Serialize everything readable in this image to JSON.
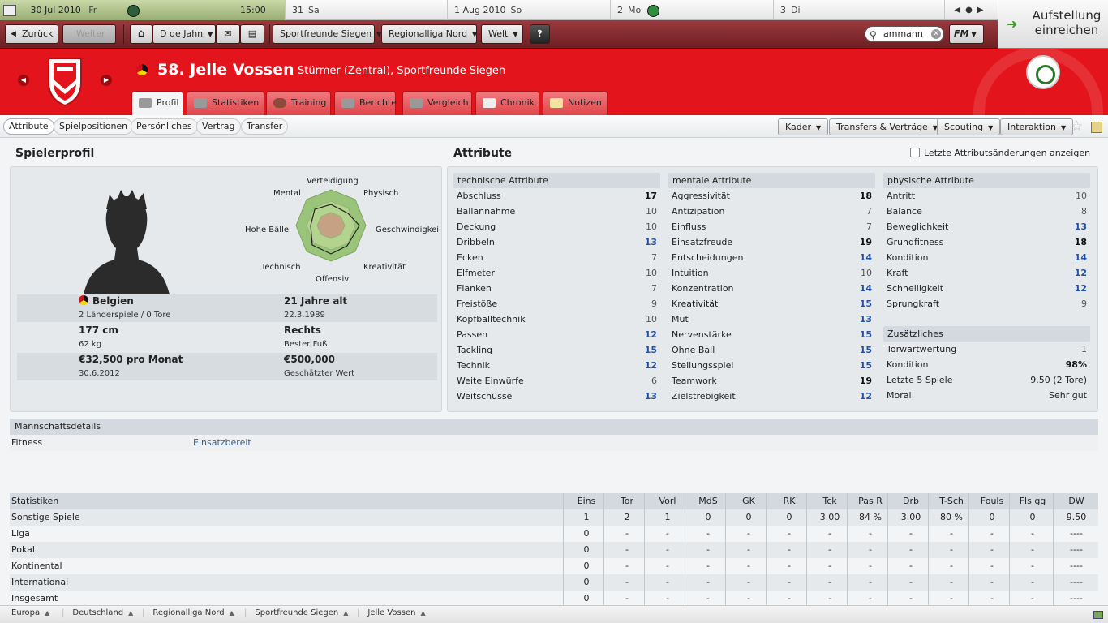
{
  "calendar": [
    {
      "day": "30 Jul 2010",
      "weekday": "Fr",
      "time": "15:00",
      "today": true
    },
    {
      "day": "31",
      "weekday": "Sa"
    },
    {
      "day": "1 Aug 2010",
      "weekday": "So"
    },
    {
      "day": "2",
      "weekday": "Mo"
    },
    {
      "day": "3",
      "weekday": "Di"
    }
  ],
  "toolbar": {
    "back": "Zurück",
    "forward": "Weiter",
    "manager": "D de Jahn",
    "club": "Sportfreunde Siegen",
    "league": "Regionalliga Nord",
    "world": "Welt",
    "help": "?",
    "search": "ammann",
    "fm": "FM"
  },
  "continue_label": "Aufstellung einreichen",
  "player": {
    "name": "58. Jelle Vossen",
    "position": "Stürmer (Zentral), Sportfreunde Siegen"
  },
  "tabs": [
    "Profil",
    "Statistiken",
    "Training",
    "Berichte",
    "Vergleich",
    "Chronik",
    "Notizen"
  ],
  "subtabs": [
    "Attribute",
    "Spielpositionen",
    "Persönliches",
    "Vertrag",
    "Transfer"
  ],
  "menus": [
    "Kader",
    "Transfers & Verträge",
    "Scouting",
    "Interaktion"
  ],
  "profile": {
    "title": "Spielerprofil",
    "radar": [
      "Verteidigung",
      "Physisch",
      "Geschwindigkei",
      "Kreativität",
      "Offensiv",
      "Technisch",
      "Hohe Bälle",
      "Mental"
    ],
    "nation": "Belgien",
    "caps": "2 Länderspiele / 0 Tore",
    "age": "21 Jahre alt",
    "dob": "22.3.1989",
    "height": "177 cm",
    "weight": "62 kg",
    "foot": "Rechts",
    "foot_label": "Bester Fuß",
    "wage": "€32,500 pro Monat",
    "contract": "30.6.2012",
    "value": "€500,000",
    "value_label": "Geschätzter Wert"
  },
  "attributes": {
    "title": "Attribute",
    "toggle": "Letzte Attributsänderungen anzeigen",
    "technical_title": "technische Attribute",
    "technical": [
      [
        "Abschluss",
        "17"
      ],
      [
        "Ballannahme",
        "10"
      ],
      [
        "Deckung",
        "10"
      ],
      [
        "Dribbeln",
        "13"
      ],
      [
        "Ecken",
        "7"
      ],
      [
        "Elfmeter",
        "10"
      ],
      [
        "Flanken",
        "7"
      ],
      [
        "Freistöße",
        "9"
      ],
      [
        "Kopfballtechnik",
        "10"
      ],
      [
        "Passen",
        "12"
      ],
      [
        "Tackling",
        "15"
      ],
      [
        "Technik",
        "12"
      ],
      [
        "Weite Einwürfe",
        "6"
      ],
      [
        "Weitschüsse",
        "13"
      ]
    ],
    "mental_title": "mentale Attribute",
    "mental": [
      [
        "Aggressivität",
        "18"
      ],
      [
        "Antizipation",
        "7"
      ],
      [
        "Einfluss",
        "7"
      ],
      [
        "Einsatzfreude",
        "19"
      ],
      [
        "Entscheidungen",
        "14"
      ],
      [
        "Intuition",
        "10"
      ],
      [
        "Konzentration",
        "14"
      ],
      [
        "Kreativität",
        "15"
      ],
      [
        "Mut",
        "13"
      ],
      [
        "Nervenstärke",
        "15"
      ],
      [
        "Ohne Ball",
        "15"
      ],
      [
        "Stellungsspiel",
        "15"
      ],
      [
        "Teamwork",
        "19"
      ],
      [
        "Zielstrebigkeit",
        "12"
      ]
    ],
    "physical_title": "physische Attribute",
    "physical": [
      [
        "Antritt",
        "10"
      ],
      [
        "Balance",
        "8"
      ],
      [
        "Beweglichkeit",
        "13"
      ],
      [
        "Grundfitness",
        "18"
      ],
      [
        "Kondition",
        "14"
      ],
      [
        "Kraft",
        "12"
      ],
      [
        "Schnelligkeit",
        "12"
      ],
      [
        "Sprungkraft",
        "9"
      ]
    ],
    "extra_title": "Zusätzliches",
    "extra": [
      [
        "Torwartwertung",
        "1"
      ],
      [
        "Kondition",
        "98%"
      ],
      [
        "Letzte 5 Spiele",
        "9.50 (2 Tore)"
      ],
      [
        "Moral",
        "Sehr gut"
      ]
    ]
  },
  "team": {
    "title": "Mannschaftsdetails",
    "label": "Fitness",
    "value": "Einsatzbereit"
  },
  "stats": {
    "headers": [
      "Statistiken",
      "Eins",
      "Tor",
      "Vorl",
      "MdS",
      "GK",
      "RK",
      "Tck",
      "Pas R",
      "Drb",
      "T-Sch",
      "Fouls",
      "Fls gg",
      "DW"
    ],
    "rows": [
      [
        "Sonstige Spiele",
        "1",
        "2",
        "1",
        "0",
        "0",
        "0",
        "3.00",
        "84 %",
        "3.00",
        "80 %",
        "0",
        "0",
        "9.50"
      ],
      [
        "Liga",
        "0",
        "-",
        "-",
        "-",
        "-",
        "-",
        "-",
        "-",
        "-",
        "-",
        "-",
        "-",
        "----"
      ],
      [
        "Pokal",
        "0",
        "-",
        "-",
        "-",
        "-",
        "-",
        "-",
        "-",
        "-",
        "-",
        "-",
        "-",
        "----"
      ],
      [
        "Kontinental",
        "0",
        "-",
        "-",
        "-",
        "-",
        "-",
        "-",
        "-",
        "-",
        "-",
        "-",
        "-",
        "----"
      ],
      [
        "International",
        "0",
        "-",
        "-",
        "-",
        "-",
        "-",
        "-",
        "-",
        "-",
        "-",
        "-",
        "-",
        "----"
      ],
      [
        "Insgesamt",
        "0",
        "-",
        "-",
        "-",
        "-",
        "-",
        "-",
        "-",
        "-",
        "-",
        "-",
        "-",
        "----"
      ]
    ]
  },
  "breadcrumbs": [
    "Europa",
    "Deutschland",
    "Regionalliga Nord",
    "Sportfreunde Siegen",
    "Jelle Vossen"
  ]
}
